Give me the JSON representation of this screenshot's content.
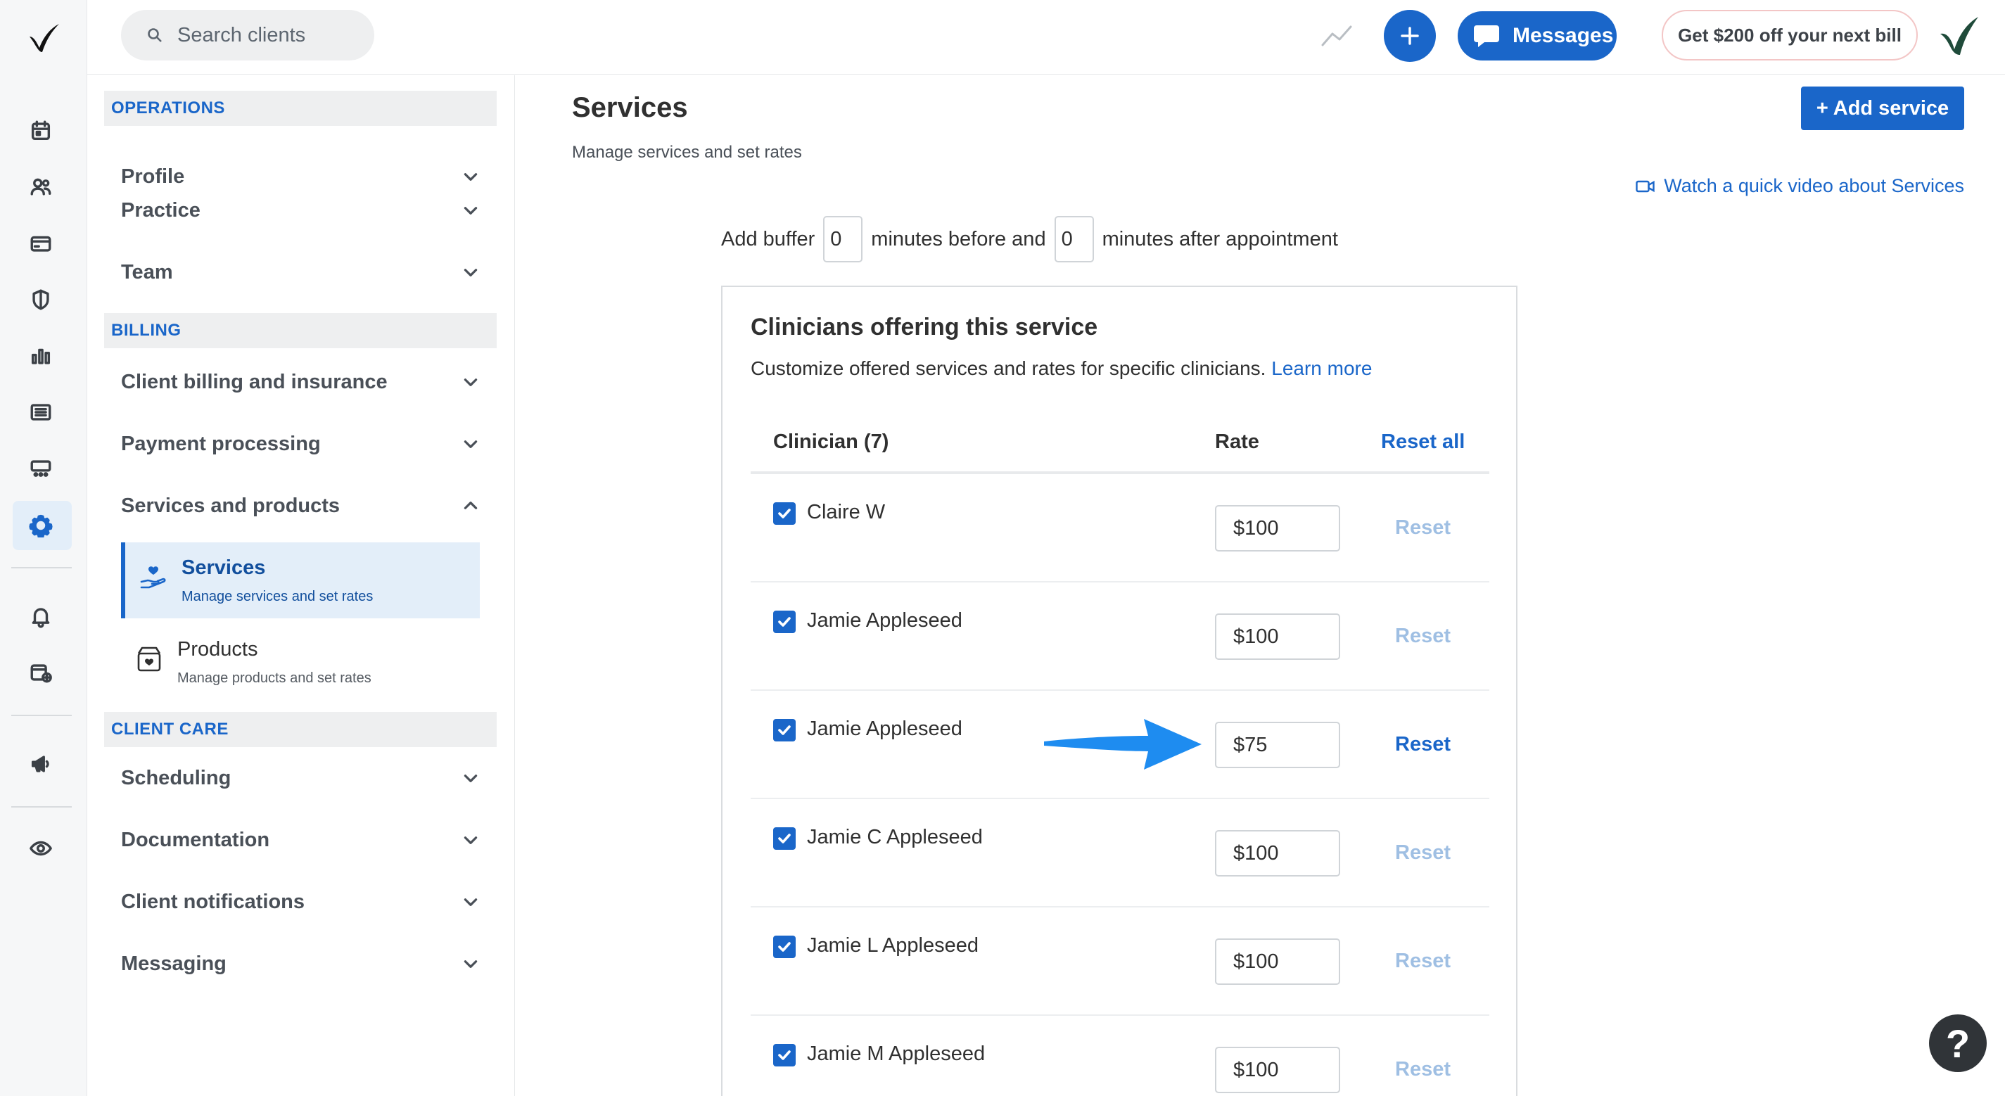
{
  "topbar": {
    "search_placeholder": "Search clients",
    "messages_label": "Messages",
    "promo_label": "Get $200 off your next bill"
  },
  "rail": {
    "icons": [
      "calendar-icon",
      "clients-icon",
      "billing-card-icon",
      "insurance-shield-icon",
      "analytics-icon",
      "activity-list-icon",
      "marketplace-icon",
      "settings-gear-icon",
      "notifications-bell-icon",
      "requests-calendar-icon",
      "marketing-megaphone-icon",
      "view-eye-icon"
    ]
  },
  "settings_nav": {
    "operations_header": "OPERATIONS",
    "operations": [
      "Profile",
      "Practice",
      "Team"
    ],
    "billing_header": "BILLING",
    "billing": [
      "Client billing and insurance",
      "Payment processing",
      "Services and products"
    ],
    "services_sub": {
      "title": "Services",
      "desc": "Manage services and set rates"
    },
    "products_sub": {
      "title": "Products",
      "desc": "Manage products and set rates"
    },
    "client_care_header": "CLIENT CARE",
    "client_care": [
      "Scheduling",
      "Documentation",
      "Client notifications",
      "Messaging"
    ]
  },
  "main": {
    "title": "Services",
    "subtitle": "Manage services and set rates",
    "add_service_label": "+ Add service",
    "video_link": "Watch a quick video about Services",
    "buffer": {
      "prefix": "Add buffer",
      "before_value": "0",
      "middle": "minutes before and",
      "after_value": "0",
      "suffix": "minutes after appointment"
    }
  },
  "clinicians_card": {
    "title": "Clinicians offering this service",
    "subtitle": "Customize offered services and rates for specific clinicians.",
    "learn_more": "Learn more",
    "col_clinician": "Clinician (7)",
    "col_rate": "Rate",
    "reset_all": "Reset all",
    "reset_label": "Reset",
    "rows": [
      {
        "name": "Claire W",
        "rate": "$100",
        "reset_active": false
      },
      {
        "name": "Jamie Appleseed",
        "rate": "$100",
        "reset_active": false
      },
      {
        "name": "Jamie Appleseed",
        "rate": "$75",
        "reset_active": true
      },
      {
        "name": "Jamie C Appleseed",
        "rate": "$100",
        "reset_active": false
      },
      {
        "name": "Jamie L Appleseed",
        "rate": "$100",
        "reset_active": false
      },
      {
        "name": "Jamie M Appleseed",
        "rate": "$100",
        "reset_active": false
      }
    ]
  },
  "colors": {
    "accent": "#1a66c9",
    "active_nav_bg": "#e3eef9",
    "annotation_arrow": "#1e8cf0"
  },
  "help_label": "?"
}
